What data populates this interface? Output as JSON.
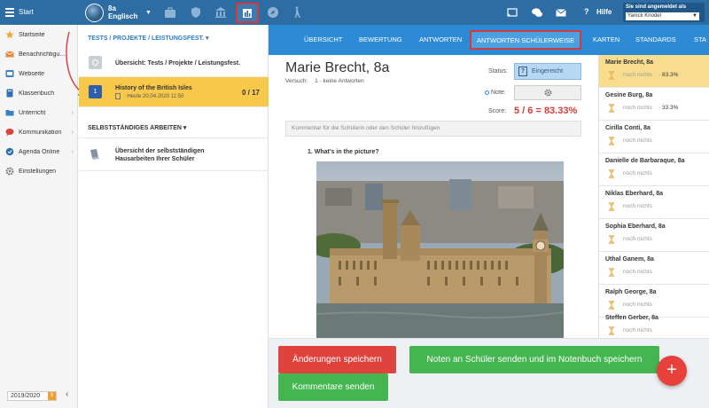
{
  "topbar": {
    "start_label": "Start",
    "class_line1": "8a",
    "class_line2": "Englisch",
    "help_label": "Hilfe",
    "login_line": "Sie sind angemeldet als",
    "login_user": "Yanick Knodel"
  },
  "sidebar": {
    "items": [
      {
        "label": "Startseite",
        "icon": "star-icon"
      },
      {
        "label": "Benachrichtigu...",
        "icon": "envelope-icon"
      },
      {
        "label": "Webseite",
        "icon": "web-icon"
      },
      {
        "label": "Klassenbuch",
        "icon": "book-icon"
      },
      {
        "label": "Unterricht",
        "icon": "folder-icon"
      },
      {
        "label": "Kommunikation",
        "icon": "chat-icon"
      },
      {
        "label": "Agenda Online",
        "icon": "agenda-icon"
      },
      {
        "label": "Einstellungen",
        "icon": "gear-icon"
      }
    ],
    "school_year": "2019/2020"
  },
  "tasks": {
    "section1_title": "TESTS / PROJEKTE / LEISTUNGSFEST.",
    "overview1_title": "Übersicht: Tests / Projekte / Leistungsfest.",
    "task_number": "1",
    "task_title": "History of the British Isles",
    "task_date": "· Heute 20.04.2020 11:50",
    "task_count": "0 / 17",
    "section2_title": "SELBSTSTÄNDIGES ARBEITEN",
    "overview2_line1": "Übersicht der selbstständigen",
    "overview2_line2": "Hausarbeiten Ihrer Schüler"
  },
  "tabs": [
    "ÜBERSICHT",
    "BEWERTUNG",
    "ANTWORTEN",
    "ANTWORTEN SCHÜLERWEISE",
    "KARTEN",
    "STANDARDS",
    "STA"
  ],
  "detail": {
    "student_name": "Marie Brecht, 8a",
    "attempt_label": "Versuch:",
    "attempt_value": "1 · keine Antworten",
    "status_label": "Status:",
    "status_value": "Eingereicht",
    "note_label": "Note:",
    "score_label": "Score:",
    "score_value": "5 / 6 = 83.33%",
    "comment_placeholder": "Kommentar für die Schülerin oder den Schüler hinzufügen",
    "question": "1.  What's in the picture?"
  },
  "buttons": {
    "save": "Änderungen speichern",
    "send_grades": "Noten an Schüler senden und im Notenbuch speichern",
    "send_comments": "Kommentare senden",
    "fab": "+"
  },
  "students": [
    {
      "name": "Marie Brecht, 8a",
      "state": "noch nichts",
      "score": "· 83.3%"
    },
    {
      "name": "Gesine Burg, 8a",
      "state": "noch nichts",
      "score": "· 33.3%"
    },
    {
      "name": "Cirilla Conti, 8a",
      "state": "noch nichts",
      "score": ""
    },
    {
      "name": "Danielle de Barbaraque, 8a",
      "state": "noch nichts",
      "score": ""
    },
    {
      "name": "Niklas Eberhard, 8a",
      "state": "noch nichts",
      "score": ""
    },
    {
      "name": "Sophia Eberhard, 8a",
      "state": "noch nichts",
      "score": ""
    },
    {
      "name": "Uthal Ganem, 8a",
      "state": "noch nichts",
      "score": ""
    },
    {
      "name": "Ralph George, 8a",
      "state": "noch nichts",
      "score": ""
    },
    {
      "name": "Steffen Gerber, 8a",
      "state": "noch nichts",
      "score": ""
    }
  ],
  "colors": {
    "topbar": "#2d6da3",
    "tabbar": "#2d8bd6",
    "selected_task": "#f7c84a",
    "selected_student": "#f9dd8e",
    "highlight_border": "#d43a3a",
    "score": "#d43a3a",
    "save_button": "#e0433c",
    "send_button": "#44b550"
  }
}
